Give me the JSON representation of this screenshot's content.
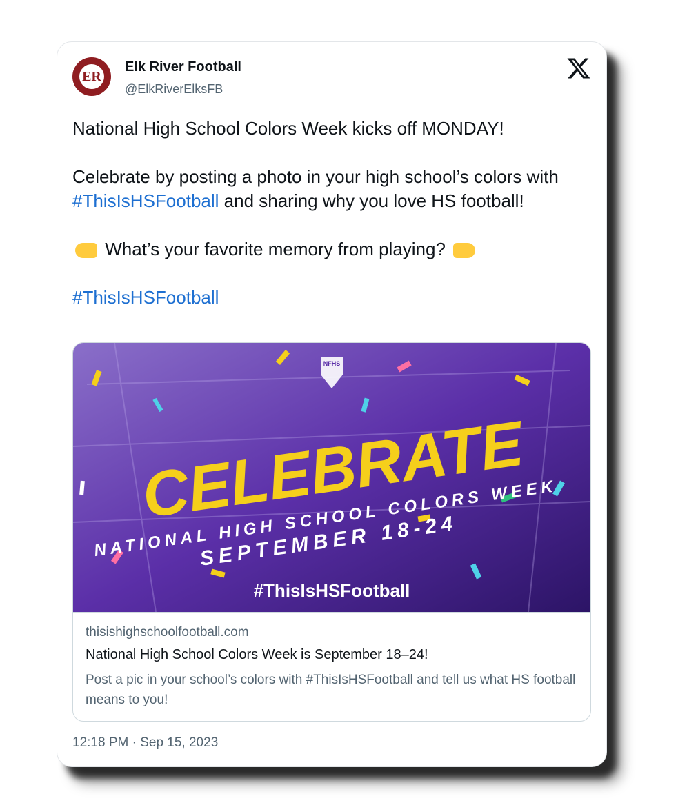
{
  "author": {
    "name": "Elk River Football",
    "handle": "@ElkRiverElksFB",
    "avatar_text": "ER"
  },
  "tweet": {
    "line1": "National High School Colors Week kicks off MONDAY!",
    "para2_before": "Celebrate by posting a photo in your high school’s colors with ",
    "para2_hashtag": "#ThisIsHSFootball",
    "para2_after": " and sharing why you love HS football!",
    "para3": "What’s your favorite memory from playing?",
    "para4_hashtag": "#ThisIsHSFootball"
  },
  "media": {
    "logo_text": "NFHS",
    "headline": "CELEBRATE",
    "subline1": "NATIONAL HIGH SCHOOL COLORS WEEK",
    "subline2": "SEPTEMBER 18-24",
    "hashtag": "#ThisIsHSFootball"
  },
  "link_card": {
    "domain": "thisishighschoolfootball.com",
    "title": "National High School Colors Week is September 18–24!",
    "description": "Post a pic in your school’s colors with #ThisIsHSFootball and tell us what HS football means to you!"
  },
  "timestamp": "12:18 PM · Sep 15, 2023",
  "colors": {
    "link": "#1d6fd1",
    "avatar": "#8f1d21",
    "banner_purple": "#5b2fa8",
    "headline_yellow": "#f5cf1b"
  },
  "icons": [
    "x-logo-icon",
    "pointing-right-emoji-icon",
    "pointing-left-emoji-icon"
  ]
}
